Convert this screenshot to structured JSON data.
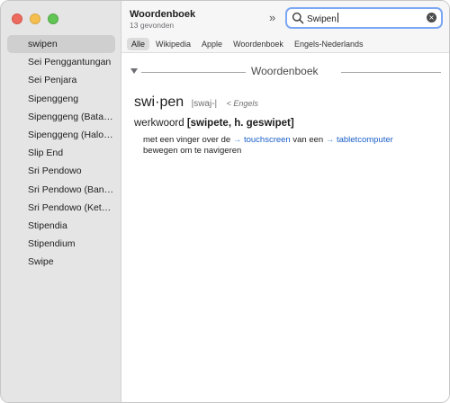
{
  "sidebar": {
    "items": [
      {
        "label": "swipen",
        "selected": true
      },
      {
        "label": "Sei Penggantungan"
      },
      {
        "label": "Sei Penjara"
      },
      {
        "label": "Sipenggeng"
      },
      {
        "label": "Sipenggeng (Batan…"
      },
      {
        "label": "Sipenggeng (Halon…"
      },
      {
        "label": "Slip End"
      },
      {
        "label": "Sri Pendowo"
      },
      {
        "label": "Sri Pendowo (Band…"
      },
      {
        "label": "Sri Pendowo (Keta…"
      },
      {
        "label": "Stipendia"
      },
      {
        "label": "Stipendium"
      },
      {
        "label": "Swipe"
      }
    ]
  },
  "header": {
    "title": "Woordenboek",
    "count": "13 gevonden",
    "chevrons": "»"
  },
  "search": {
    "value": "Swipen",
    "clear_icon": "×"
  },
  "tabs": [
    {
      "label": "Alle",
      "active": true
    },
    {
      "label": "Wikipedia"
    },
    {
      "label": "Apple"
    },
    {
      "label": "Woordenboek"
    },
    {
      "label": "Engels-Nederlands"
    }
  ],
  "entry": {
    "section_title": "Woordenboek",
    "headword": "swi·pen",
    "pronunciation": "|swaj-|",
    "origin": "< Engels",
    "pos": "werkwoord",
    "forms": "[swipete, h. geswipet]",
    "definition": {
      "part1": "met een vinger over de ",
      "arrow1": "→ ",
      "link1": "touchscreen",
      "part2": " van een ",
      "arrow2": "→ ",
      "link2": "tabletcomputer",
      "part3": "bewegen om te navigeren"
    }
  },
  "colors": {
    "sidebar_bg": "#e6e5e5",
    "selection": "#d0cfcf",
    "search_focus": "#7ba7f5",
    "link": "#1a5fc7"
  }
}
